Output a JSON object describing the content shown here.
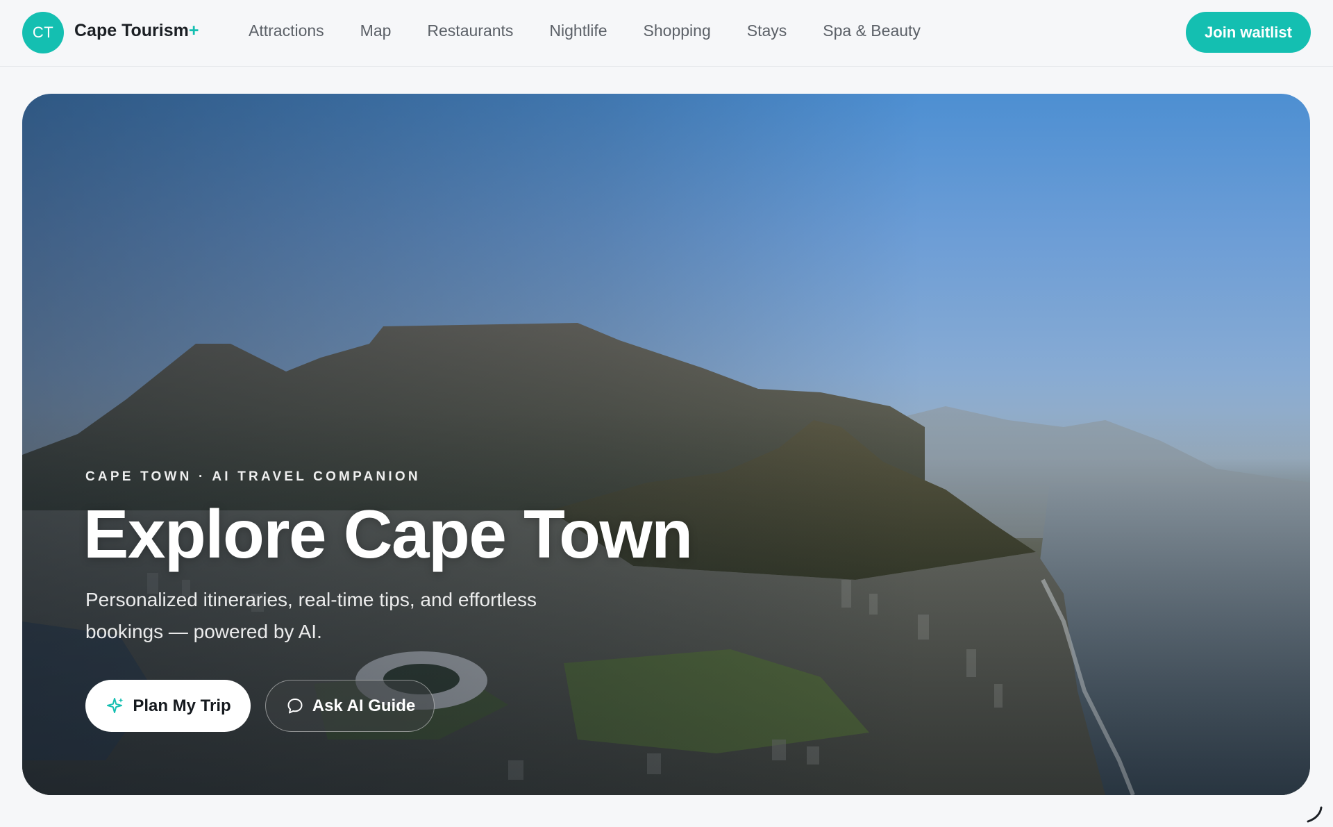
{
  "brand": {
    "initials": "CT",
    "name": "Cape Tourism",
    "plus": "+",
    "accent_color": "#14bfb1"
  },
  "nav": {
    "items": [
      {
        "label": "Attractions"
      },
      {
        "label": "Map"
      },
      {
        "label": "Restaurants"
      },
      {
        "label": "Nightlife"
      },
      {
        "label": "Shopping"
      },
      {
        "label": "Stays"
      },
      {
        "label": "Spa & Beauty"
      }
    ]
  },
  "header": {
    "cta_label": "Join waitlist"
  },
  "hero": {
    "eyebrow": "CAPE TOWN · AI TRAVEL COMPANION",
    "title": "Explore Cape Town",
    "subtitle": "Personalized itineraries, real-time tips, and effortless bookings — powered by AI.",
    "primary_button": {
      "label": "Plan My Trip",
      "icon": "sparkles-icon"
    },
    "secondary_button": {
      "label": "Ask AI Guide",
      "icon": "chat-bubble-icon"
    },
    "background": "aerial photo of Table Mountain and Cape Town city with coastline"
  },
  "status": {
    "loading_icon": "spinner-icon"
  }
}
